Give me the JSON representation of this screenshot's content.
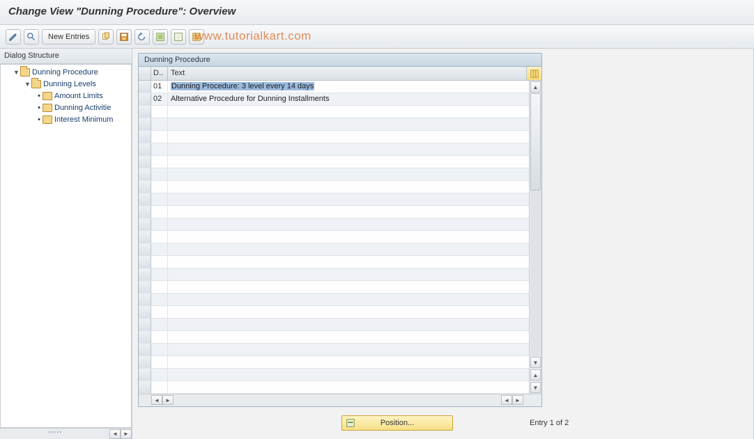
{
  "title": "Change View \"Dunning Procedure\": Overview",
  "watermark": "www.tutorialkart.com",
  "toolbar": {
    "new_entries": "New Entries"
  },
  "sidebar": {
    "header": "Dialog Structure",
    "nodes": {
      "root": "Dunning Procedure",
      "levels": "Dunning Levels",
      "amount": "Amount Limits",
      "activities": "Dunning Activitie",
      "interest": "Interest Minimum"
    }
  },
  "panel": {
    "title": "Dunning Procedure",
    "columns": {
      "d": "D..",
      "text": "Text"
    },
    "rows": [
      {
        "d": "01",
        "text": "Dunning Procedure: 3 level every 14 days",
        "selected": true
      },
      {
        "d": "02",
        "text": "Alternative Procedure for Dunning Installments",
        "selected": false
      }
    ]
  },
  "footer": {
    "position": "Position...",
    "entry": "Entry 1 of 2"
  }
}
